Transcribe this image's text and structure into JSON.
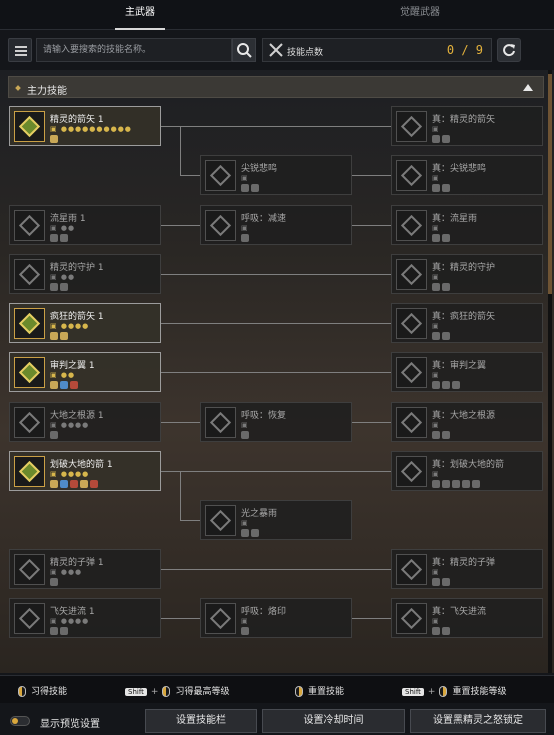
{
  "tabs": [
    {
      "label": "主武器",
      "active": true
    },
    {
      "label": "觉醒武器",
      "active": false
    }
  ],
  "toolbar": {
    "search_placeholder": "请输入要搜索的技能名称。",
    "points_label": "技能点数",
    "points_value": "0 / 9"
  },
  "section": {
    "title": "主力技能"
  },
  "colors": {
    "accent": "#e3b13c",
    "learned_border": "#caa046",
    "panel_line": "#7f7f7f"
  },
  "skills": [
    {
      "id": "s1",
      "name": "精灵的箭矢 1",
      "dots": "●●●●●●●●●●",
      "learned": true,
      "tags": [
        "p"
      ]
    },
    {
      "id": "s1t",
      "name": "真：精灵的箭矢",
      "dots": "",
      "learned": false,
      "tags": [
        "m",
        "p"
      ]
    },
    {
      "id": "s1b",
      "name": "尖锐悲鸣",
      "dots": "",
      "learned": false,
      "tags": [
        "e",
        "a"
      ]
    },
    {
      "id": "s1bt",
      "name": "真：尖锐悲鸣",
      "dots": "",
      "learned": false,
      "tags": [
        "m",
        "p"
      ]
    },
    {
      "id": "s2",
      "name": "流星雨 1",
      "dots": "●●",
      "learned": false,
      "tags": [
        "e",
        "p"
      ]
    },
    {
      "id": "s2m",
      "name": "呼吸：减速",
      "dots": "",
      "learned": false,
      "tags": [
        "m"
      ]
    },
    {
      "id": "s2t",
      "name": "真：流星雨",
      "dots": "",
      "learned": false,
      "tags": [
        "e",
        "p"
      ]
    },
    {
      "id": "s3",
      "name": "精灵的守护 1",
      "dots": "●●",
      "learned": false,
      "tags": [
        "s",
        "a"
      ]
    },
    {
      "id": "s3t",
      "name": "真：精灵的守护",
      "dots": "",
      "learned": false,
      "tags": [
        "m",
        "a"
      ]
    },
    {
      "id": "s4",
      "name": "疯狂的箭矢 1",
      "dots": "●●●●",
      "learned": true,
      "tags": [
        "e",
        "a"
      ]
    },
    {
      "id": "s4t",
      "name": "真：疯狂的箭矢",
      "dots": "",
      "learned": false,
      "tags": [
        "e",
        "a"
      ]
    },
    {
      "id": "s5",
      "name": "审判之翼 1",
      "dots": "●●",
      "learned": true,
      "tags": [
        "a",
        "b",
        "r"
      ]
    },
    {
      "id": "s5t",
      "name": "真：审判之翼",
      "dots": "",
      "learned": false,
      "tags": [
        "a",
        "b",
        "r"
      ]
    },
    {
      "id": "s6",
      "name": "大地之根源 1",
      "dots": "●●●●",
      "learned": false,
      "tags": [
        "e"
      ]
    },
    {
      "id": "s6m",
      "name": "呼吸：恢复",
      "dots": "",
      "learned": false,
      "tags": [
        "m"
      ]
    },
    {
      "id": "s6t",
      "name": "真：大地之根源",
      "dots": "",
      "learned": false,
      "tags": [
        "m",
        "e"
      ]
    },
    {
      "id": "s7",
      "name": "划破大地的箭 1",
      "dots": "●●●●",
      "learned": true,
      "tags": [
        "a",
        "b",
        "r",
        "a",
        "r"
      ]
    },
    {
      "id": "s7t",
      "name": "真：划破大地的箭",
      "dots": "",
      "learned": false,
      "tags": [
        "a",
        "b",
        "r",
        "a",
        "r"
      ]
    },
    {
      "id": "s7b",
      "name": "光之暴雨",
      "dots": "",
      "learned": false,
      "tags": [
        "s",
        "a"
      ]
    },
    {
      "id": "s8",
      "name": "精灵的子弹 1",
      "dots": "●●●",
      "learned": false,
      "tags": [
        "a"
      ]
    },
    {
      "id": "s8t",
      "name": "真：精灵的子弹",
      "dots": "",
      "learned": false,
      "tags": [
        "m",
        "a"
      ]
    },
    {
      "id": "s9",
      "name": "飞矢进流 1",
      "dots": "●●●●",
      "learned": false,
      "tags": [
        "s",
        "a"
      ]
    },
    {
      "id": "s9m",
      "name": "呼吸：烙印",
      "dots": "",
      "learned": false,
      "tags": [
        "m"
      ]
    },
    {
      "id": "s9t",
      "name": "真：飞矢进流",
      "dots": "",
      "learned": false,
      "tags": [
        "m",
        "a"
      ]
    }
  ],
  "hints": {
    "learn": "习得技能",
    "shift": "Shift",
    "learn_max": "习得最高等级",
    "reset": "重置技能",
    "reset_level": "重置技能等级"
  },
  "bottom": {
    "preview": "显示预览设置",
    "skillbar": "设置技能栏",
    "cooldown": "设置冷却时间",
    "fury": "设置黑精灵之怒锁定"
  }
}
